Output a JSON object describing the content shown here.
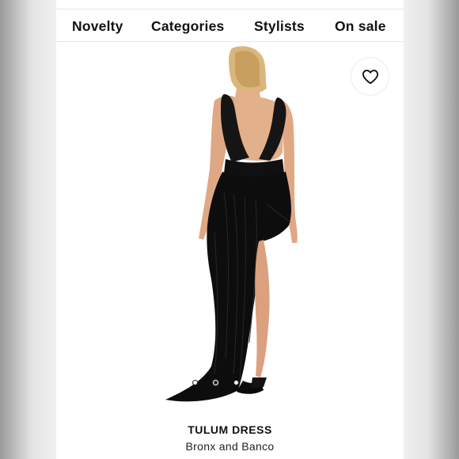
{
  "nav": {
    "items": [
      {
        "label": "Novelty"
      },
      {
        "label": "Categories"
      },
      {
        "label": "Stylists"
      },
      {
        "label": "On sale"
      }
    ]
  },
  "product": {
    "title": "TULUM DRESS",
    "brand": "Bronx and Banco",
    "image_icon": "dress-photo",
    "carousel": {
      "count": 3,
      "active_index": 1
    }
  },
  "icons": {
    "favorite": "heart-icon"
  },
  "colors": {
    "text": "#111111",
    "background": "#ffffff",
    "dress": "#0c0c0c"
  }
}
